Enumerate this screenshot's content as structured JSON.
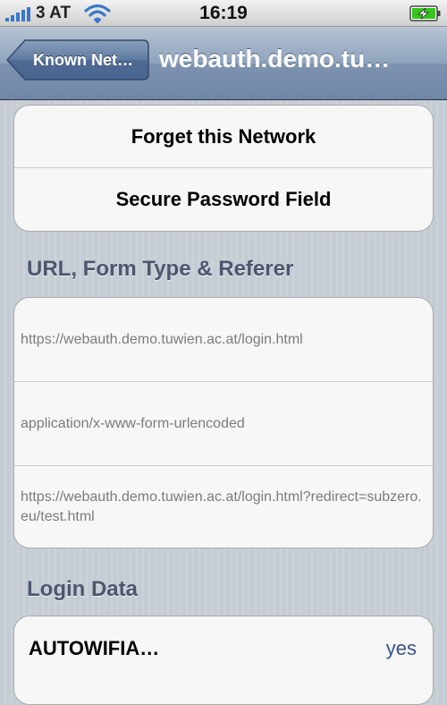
{
  "status_bar": {
    "carrier": "3 AT",
    "time": "16:19",
    "signal_icon": "signal-bars-icon",
    "wifi_icon": "wifi-icon",
    "battery_icon": "battery-charging-icon"
  },
  "nav": {
    "back_label": "Known Net…",
    "title": "webauth.demo.tu…"
  },
  "actions": {
    "forget_label": "Forget this Network",
    "secure_label": "Secure Password Field"
  },
  "url_section": {
    "header": "URL, Form Type & Referer",
    "url": "https://webauth.demo.tuwien.ac.at/login.html",
    "form_type": "application/x-www-form-urlencoded",
    "referer": "https://webauth.demo.tuwien.ac.at/login.html?redirect=subzero.eu/test.html"
  },
  "login_section": {
    "header": "Login Data",
    "rows": [
      {
        "label": "AUTOWIFIA…",
        "value": "yes"
      }
    ]
  },
  "colors": {
    "nav_bar": "#7d93b0",
    "background": "#c5ccd4",
    "value_blue": "#385487",
    "header_text": "#4c566c"
  }
}
